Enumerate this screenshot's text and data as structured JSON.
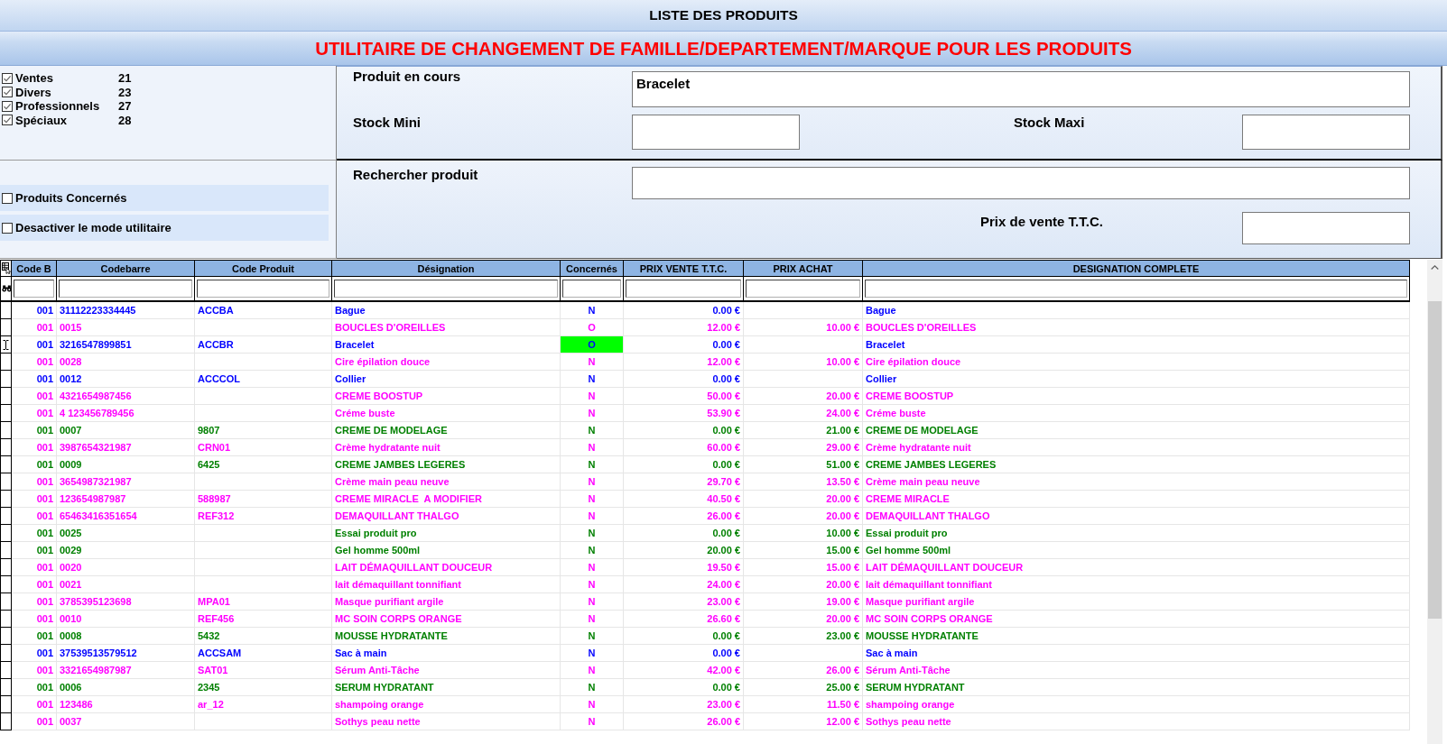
{
  "window": {
    "title": "LISTE DES PRODUITS",
    "subtitle": "UTILITAIRE DE CHANGEMENT DE FAMILLE/DEPARTEMENT/MARQUE POUR LES PRODUITS"
  },
  "families": [
    {
      "label": "Ventes",
      "count": "21",
      "checked": true
    },
    {
      "label": "Divers",
      "count": "23",
      "checked": true
    },
    {
      "label": "Professionnels",
      "count": "27",
      "checked": true
    },
    {
      "label": "Spéciaux",
      "count": "28",
      "checked": true
    }
  ],
  "options": [
    {
      "label": "Produits Concernés",
      "checked": false
    },
    {
      "label": "Desactiver le mode utilitaire",
      "checked": false
    }
  ],
  "product_panel": {
    "current_product": {
      "label": "Produit en cours",
      "value": "Bracelet"
    },
    "stock_min": {
      "label": "Stock Mini"
    },
    "stock_max": {
      "label": "Stock Maxi"
    }
  },
  "search_panel": {
    "search": {
      "label": "Rechercher produit"
    },
    "sale_price": {
      "label": "Prix de vente T.T.C."
    }
  },
  "table": {
    "columns": [
      "Code B",
      "Codebarre",
      "Code Produit",
      "Désignation",
      "Concernés",
      "PRIX VENTE T.T.C.",
      "PRIX ACHAT",
      "DESIGNATION COMPLETE"
    ],
    "rows": [
      {
        "code_b": "001",
        "codebarre": "31112223334445",
        "code_produit": "ACCBA",
        "designation": "Bague",
        "concernes": "N",
        "prix_vente": "0.00 €",
        "designation_complete": "Bague",
        "color": "#0000ff",
        "selected": false
      },
      {
        "code_b": "001",
        "codebarre": "0015",
        "designation": "BOUCLES D'OREILLES",
        "concernes": "O",
        "prix_vente": "12.00 €",
        "prix_achat": "10.00 €",
        "designation_complete": "BOUCLES D'OREILLES",
        "color": "#ff00ff",
        "selected": false
      },
      {
        "code_b": "001",
        "codebarre": "3216547899851",
        "code_produit": "ACCBR",
        "designation": "Bracelet",
        "concernes": "O",
        "prix_vente": "0.00 €",
        "designation_complete": "Bracelet",
        "color": "#0000ff",
        "selected": true
      },
      {
        "code_b": "001",
        "codebarre": "0028",
        "designation": "Cire épilation douce",
        "concernes": "N",
        "prix_vente": "12.00 €",
        "prix_achat": "10.00 €",
        "designation_complete": "Cire épilation douce",
        "color": "#ff00ff",
        "selected": false
      },
      {
        "code_b": "001",
        "codebarre": "0012",
        "code_produit": "ACCCOL",
        "designation": "Collier",
        "concernes": "N",
        "prix_vente": "0.00 €",
        "designation_complete": "Collier",
        "color": "#0000ff",
        "selected": false
      },
      {
        "code_b": "001",
        "codebarre": "4321654987456",
        "designation": "CREME BOOSTUP",
        "concernes": "N",
        "prix_vente": "50.00 €",
        "prix_achat": "20.00 €",
        "designation_complete": "CREME BOOSTUP",
        "color": "#ff00ff",
        "selected": false
      },
      {
        "code_b": "001",
        "codebarre": "4 123456789456",
        "designation": "Créme buste",
        "concernes": "N",
        "prix_vente": "53.90 €",
        "prix_achat": "24.00 €",
        "designation_complete": "Créme buste",
        "color": "#ff00ff",
        "selected": false
      },
      {
        "code_b": "001",
        "codebarre": "0007",
        "code_produit": "9807",
        "designation": "CREME DE MODELAGE",
        "concernes": "N",
        "prix_vente": "0.00 €",
        "prix_achat": "21.00 €",
        "designation_complete": "CREME DE MODELAGE",
        "color": "#008000",
        "selected": false
      },
      {
        "code_b": "001",
        "codebarre": "3987654321987",
        "code_produit": "CRN01",
        "designation": "Crème hydratante nuit",
        "concernes": "N",
        "prix_vente": "60.00 €",
        "prix_achat": "29.00 €",
        "designation_complete": "Crème hydratante nuit",
        "color": "#ff00ff",
        "selected": false
      },
      {
        "code_b": "001",
        "codebarre": "0009",
        "code_produit": "6425",
        "designation": "CREME JAMBES LEGERES",
        "concernes": "N",
        "prix_vente": "0.00 €",
        "prix_achat": "51.00 €",
        "designation_complete": "CREME JAMBES LEGERES",
        "color": "#008000",
        "selected": false
      },
      {
        "code_b": "001",
        "codebarre": "3654987321987",
        "designation": "Crème main peau neuve",
        "concernes": "N",
        "prix_vente": "29.70 €",
        "prix_achat": "13.50 €",
        "designation_complete": "Crème main peau neuve",
        "color": "#ff00ff",
        "selected": false
      },
      {
        "code_b": "001",
        "codebarre": "123654987987",
        "code_produit": "588987",
        "designation": "CREME MIRACLE  A MODIFIER",
        "concernes": "N",
        "prix_vente": "40.50 €",
        "prix_achat": "20.00 €",
        "designation_complete": "CREME MIRACLE",
        "color": "#ff00ff",
        "selected": false
      },
      {
        "code_b": "001",
        "codebarre": "65463416351654",
        "code_produit": "REF312",
        "designation": "DEMAQUILLANT THALGO",
        "concernes": "N",
        "prix_vente": "26.00 €",
        "prix_achat": "20.00 €",
        "designation_complete": "DEMAQUILLANT THALGO",
        "color": "#ff00ff",
        "selected": false
      },
      {
        "code_b": "001",
        "codebarre": "0025",
        "designation": "Essai produit pro",
        "concernes": "N",
        "prix_vente": "0.00 €",
        "prix_achat": "10.00 €",
        "designation_complete": "Essai produit pro",
        "color": "#008000",
        "selected": false
      },
      {
        "code_b": "001",
        "codebarre": "0029",
        "designation": "Gel homme 500ml",
        "concernes": "N",
        "prix_vente": "20.00 €",
        "prix_achat": "15.00 €",
        "designation_complete": "Gel homme 500ml",
        "color": "#008000",
        "selected": false
      },
      {
        "code_b": "001",
        "codebarre": "0020",
        "designation": "LAIT DÉMAQUILLANT DOUCEUR",
        "concernes": "N",
        "prix_vente": "19.50 €",
        "prix_achat": "15.00 €",
        "designation_complete": "LAIT DÉMAQUILLANT DOUCEUR",
        "color": "#ff00ff",
        "selected": false
      },
      {
        "code_b": "001",
        "codebarre": "0021",
        "designation": "lait démaquillant tonnifiant",
        "concernes": "N",
        "prix_vente": "24.00 €",
        "prix_achat": "20.00 €",
        "designation_complete": "lait démaquillant tonnifiant",
        "color": "#ff00ff",
        "selected": false
      },
      {
        "code_b": "001",
        "codebarre": "3785395123698",
        "code_produit": "MPA01",
        "designation": "Masque purifiant argile",
        "concernes": "N",
        "prix_vente": "23.00 €",
        "prix_achat": "19.00 €",
        "designation_complete": "Masque purifiant argile",
        "color": "#ff00ff",
        "selected": false
      },
      {
        "code_b": "001",
        "codebarre": "0010",
        "code_produit": "REF456",
        "designation": "MC SOIN CORPS ORANGE",
        "concernes": "N",
        "prix_vente": "26.60 €",
        "prix_achat": "20.00 €",
        "designation_complete": "MC SOIN CORPS ORANGE",
        "color": "#ff00ff",
        "selected": false
      },
      {
        "code_b": "001",
        "codebarre": "0008",
        "code_produit": "5432",
        "designation": "MOUSSE HYDRATANTE",
        "concernes": "N",
        "prix_vente": "0.00 €",
        "prix_achat": "23.00 €",
        "designation_complete": "MOUSSE HYDRATANTE",
        "color": "#008000",
        "selected": false
      },
      {
        "code_b": "001",
        "codebarre": "37539513579512",
        "code_produit": "ACCSAM",
        "designation": "Sac à main",
        "concernes": "N",
        "prix_vente": "0.00 €",
        "designation_complete": "Sac à main",
        "color": "#0000ff",
        "selected": false
      },
      {
        "code_b": "001",
        "codebarre": "3321654987987",
        "code_produit": "SAT01",
        "designation": "Sérum Anti-Tâche",
        "concernes": "N",
        "prix_vente": "42.00 €",
        "prix_achat": "26.00 €",
        "designation_complete": "Sérum Anti-Tâche",
        "color": "#ff00ff",
        "selected": false
      },
      {
        "code_b": "001",
        "codebarre": "0006",
        "code_produit": "2345",
        "designation": "SERUM HYDRATANT",
        "concernes": "N",
        "prix_vente": "0.00 €",
        "prix_achat": "25.00 €",
        "designation_complete": "SERUM HYDRATANT",
        "color": "#008000",
        "selected": false
      },
      {
        "code_b": "001",
        "codebarre": "123486",
        "code_produit": "ar_12",
        "designation": "shampoing orange",
        "concernes": "N",
        "prix_vente": "23.00 €",
        "prix_achat": "11.50 €",
        "designation_complete": "shampoing orange",
        "color": "#ff00ff",
        "selected": false
      },
      {
        "code_b": "001",
        "codebarre": "0037",
        "designation": "Sothys peau nette",
        "concernes": "N",
        "prix_vente": "26.00 €",
        "prix_achat": "12.00 €",
        "designation_complete": "Sothys peau nette",
        "color": "#ff00ff",
        "selected": false
      }
    ]
  }
}
